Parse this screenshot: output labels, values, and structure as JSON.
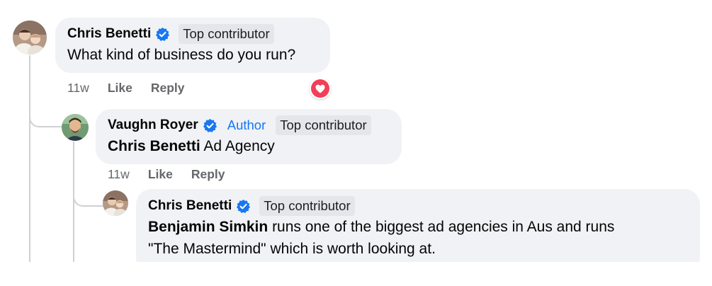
{
  "comments": [
    {
      "author": "Chris Benetti",
      "badge": "Top contributor",
      "text": "What kind of business do you run?",
      "time": "11w",
      "like_label": "Like",
      "reply_label": "Reply",
      "reaction_icon": "love-reaction-icon"
    },
    {
      "author": "Vaughn Royer",
      "author_badge": "Author",
      "badge": "Top contributor",
      "mention": "Chris Benetti",
      "text": "Ad Agency",
      "time": "11w",
      "like_label": "Like",
      "reply_label": "Reply"
    },
    {
      "author": "Chris Benetti",
      "badge": "Top contributor",
      "mention": "Benjamin Simkin",
      "text_line1": "runs one of the biggest ad agencies in Aus and runs",
      "text_line2": "\"The Mastermind\" which is worth looking at."
    }
  ],
  "colors": {
    "bubble": "#f0f2f5",
    "badge_bg": "#e4e6eb",
    "verified_blue": "#1877f2",
    "author_blue": "#1877f2",
    "love_red": "#f33e58",
    "meta_grey": "#65676b",
    "thread_line": "#ced0d4"
  }
}
